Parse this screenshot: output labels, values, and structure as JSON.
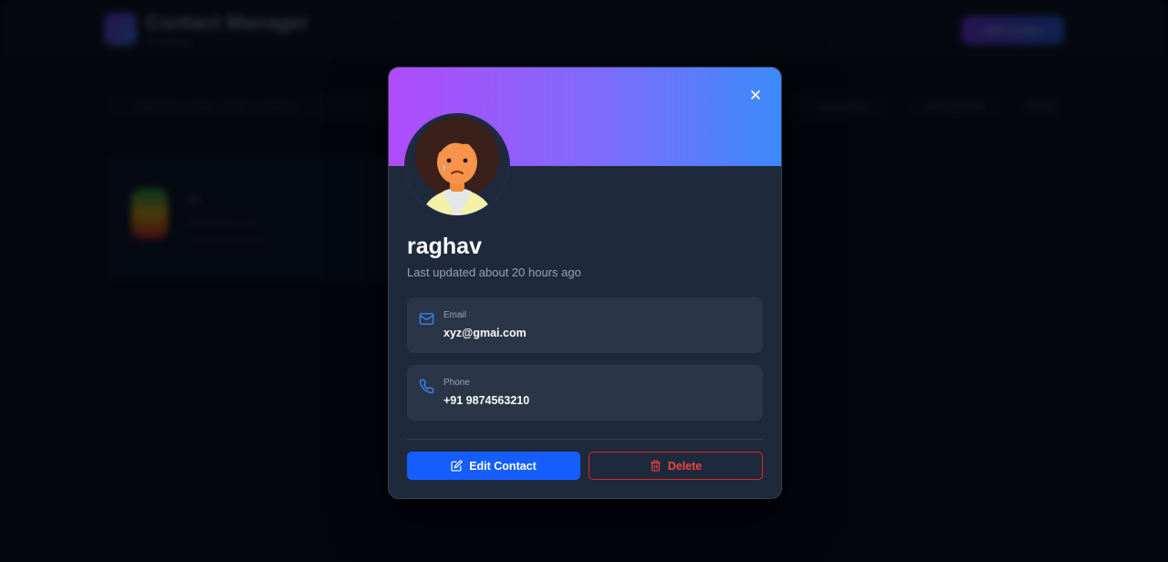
{
  "background": {
    "app_title": "Contact Manager",
    "app_subtitle": "3 contacts",
    "add_button_label": "Add Contact",
    "search_placeholder": "Search by name, email, or phone...",
    "filters": [
      "Added On",
      "All Contacts",
      "Name"
    ],
    "card": {
      "name": "ajit",
      "email": "abc@gmail.com",
      "phone": "+91 9876543210"
    }
  },
  "modal": {
    "close_icon": "x-icon",
    "name": "raghav",
    "last_updated": "Last updated about 20 hours ago",
    "email": {
      "icon": "mail-icon",
      "label": "Email",
      "value": "xyz@gmai.com"
    },
    "phone": {
      "icon": "phone-icon",
      "label": "Phone",
      "value": "+91 9874563210"
    },
    "edit_button": {
      "icon": "edit-icon",
      "label": "Edit Contact"
    },
    "delete_button": {
      "icon": "trash-icon",
      "label": "Delete"
    }
  },
  "colors": {
    "banner_start": "#b14bfc",
    "banner_end": "#3b8bfb",
    "primary": "#155dfc",
    "danger": "#ef4444",
    "accent_icon": "#3b82f6"
  }
}
